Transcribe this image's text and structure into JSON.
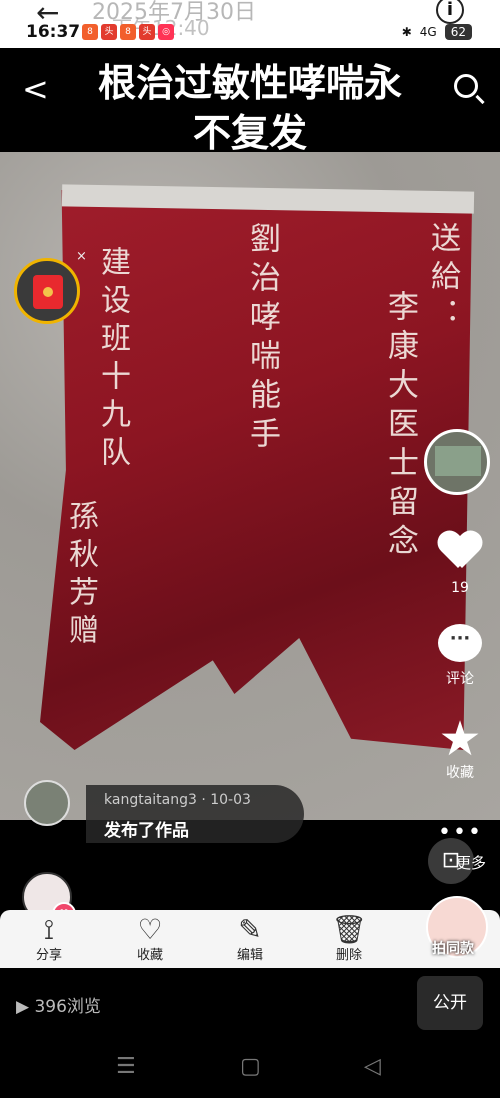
{
  "statusbar": {
    "time": "16:37",
    "ghost_line": "2025年7月30日",
    "ghost_line2": "下午12:40",
    "signal": "4G",
    "battery": "62"
  },
  "header": {
    "title_line1": "根治过敏性哮喘永",
    "title_line2": "不复发"
  },
  "banner": {
    "col1": "送給：",
    "col1b": "李康大医士留念",
    "col2": "劉治哮喘能手",
    "col3": "建设班十九队",
    "col3b": "孫秋芳赠"
  },
  "side": {
    "like_count": "19",
    "comment_label": "评论",
    "collect_label": "收藏"
  },
  "publish": {
    "username": "kangtaitang3 · 10-03",
    "text": "发布了作品"
  },
  "more": {
    "label": "更多"
  },
  "actions": [
    {
      "icon": "share-icon",
      "label": "分享"
    },
    {
      "icon": "heart-outline-icon",
      "label": "收藏"
    },
    {
      "icon": "edit-icon",
      "label": "编辑"
    },
    {
      "icon": "trash-icon",
      "label": "删除"
    },
    {
      "icon": "more-icon",
      "label": "更多"
    }
  ],
  "paitong": {
    "label": "拍同款"
  },
  "footer": {
    "views": "396浏览",
    "public_label": "公开"
  },
  "colors": {
    "flag_red": "#8c1522",
    "accent_pink": "#f0476b"
  }
}
